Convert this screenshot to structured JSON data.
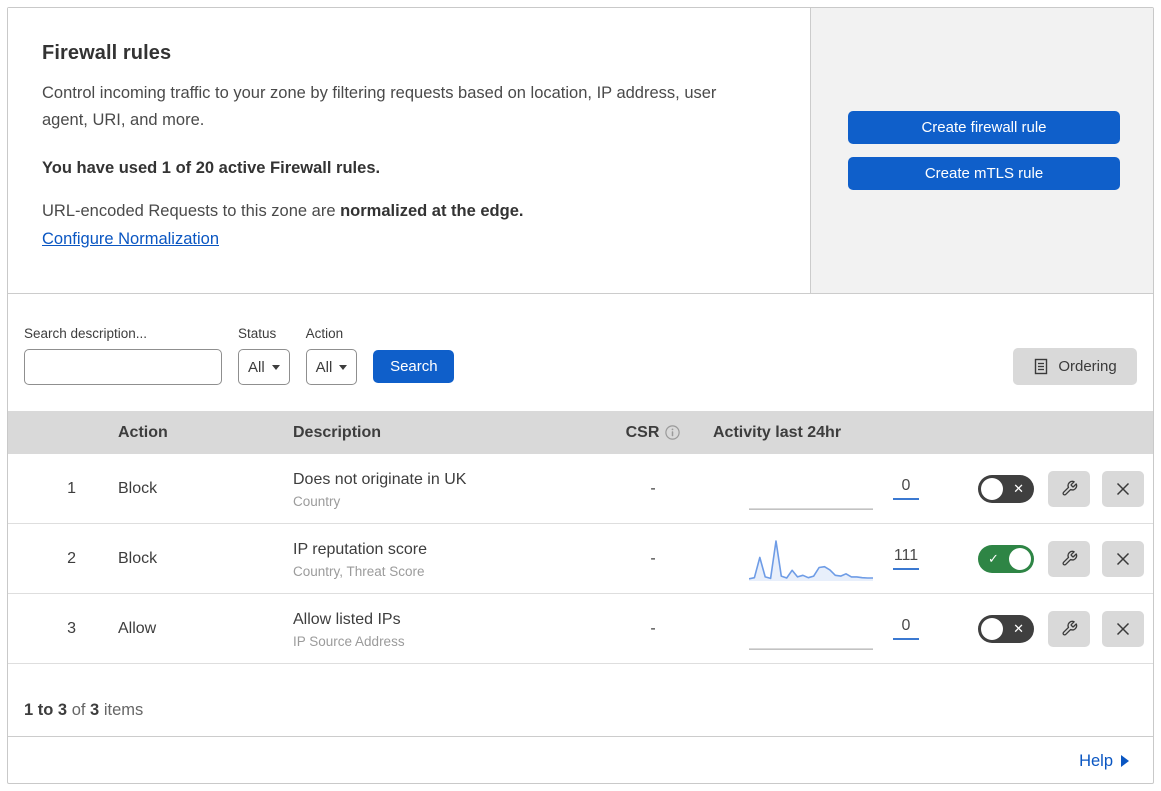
{
  "header": {
    "title": "Firewall rules",
    "description": "Control incoming traffic to your zone by filtering requests based on location, IP address, user agent, URI, and more.",
    "usage": "You have used 1 of 20 active Firewall rules.",
    "normalization_text": "URL-encoded Requests to this zone are ",
    "normalization_bold": "normalized at the edge.",
    "normalization_link": "Configure Normalization",
    "buttons": {
      "create_firewall": "Create firewall rule",
      "create_mtls": "Create mTLS rule"
    }
  },
  "filters": {
    "search_label": "Search description...",
    "search_value": "",
    "status_label": "Status",
    "status_value": "All",
    "action_label": "Action",
    "action_value": "All",
    "search_button": "Search",
    "ordering_button": "Ordering"
  },
  "table": {
    "columns": {
      "action": "Action",
      "description": "Description",
      "csr": "CSR",
      "activity": "Activity last 24hr"
    },
    "rows": [
      {
        "num": "1",
        "action": "Block",
        "description": "Does not originate in UK",
        "criteria": "Country",
        "csr": "-",
        "activity_count": "0",
        "enabled": false,
        "has_activity": false
      },
      {
        "num": "2",
        "action": "Block",
        "description": "IP reputation score",
        "criteria": "Country, Threat Score",
        "csr": "-",
        "activity_count": "111",
        "enabled": true,
        "has_activity": true
      },
      {
        "num": "3",
        "action": "Allow",
        "description": "Allow listed IPs",
        "criteria": "IP Source Address",
        "csr": "-",
        "activity_count": "0",
        "enabled": false,
        "has_activity": false
      }
    ]
  },
  "footer": {
    "items_bold_1": "1 to ",
    "items_bold_2": "3",
    "items_mid": " of ",
    "items_bold_3": "3",
    "items_suffix": " items",
    "help_label": "Help"
  },
  "chart_data": {
    "type": "area",
    "title": "Activity last 24hr sparkline (rule 2: IP reputation score)",
    "xlabel": "",
    "ylabel": "",
    "axes_visible": false,
    "ylim": [
      0,
      100
    ],
    "series": [
      {
        "name": "requests",
        "values": [
          3,
          6,
          58,
          8,
          4,
          100,
          10,
          5,
          25,
          8,
          12,
          6,
          10,
          32,
          34,
          26,
          12,
          10,
          16,
          8,
          8,
          6,
          5,
          5
        ]
      }
    ],
    "total_shown": 111
  },
  "colors": {
    "accent_blue": "#0f5fca",
    "link_blue": "#0a56c2",
    "toggle_on_green": "#2e8545",
    "toggle_off_gray": "#3f3f3f",
    "sparkline_blue": "#6e9ce6",
    "table_header_gray": "#d9d9d9",
    "panel_gray": "#f2f2f2"
  }
}
